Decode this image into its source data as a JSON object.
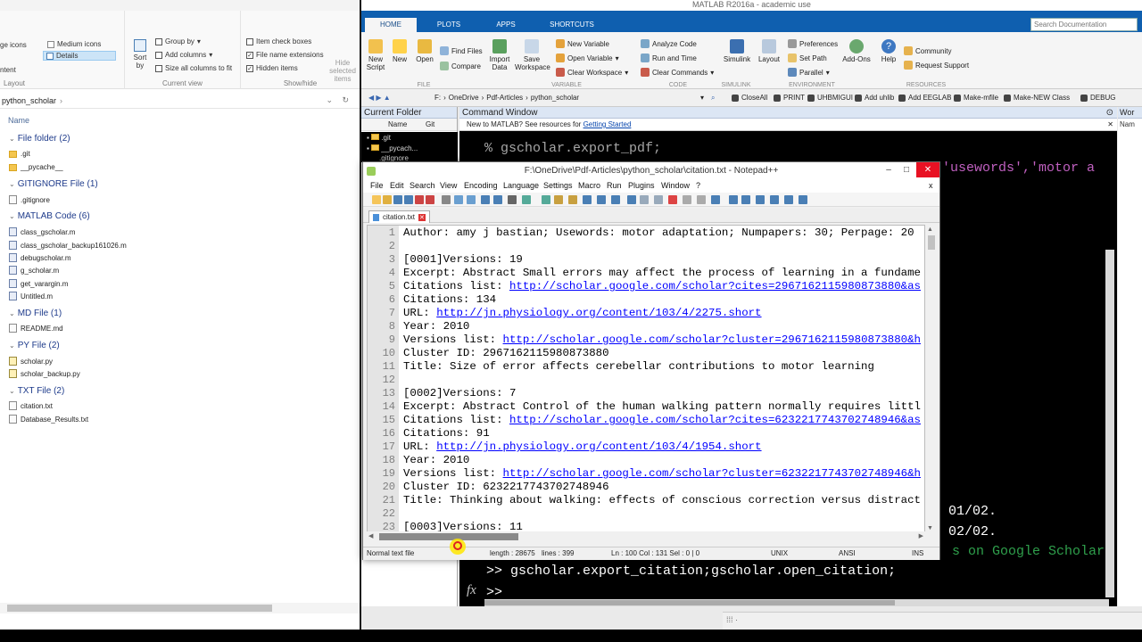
{
  "explorer": {
    "ribbon": {
      "large_icons": "ge icons",
      "medium_icons": "Medium icons",
      "content": "ntent",
      "details": "Details",
      "layout_label": "Layout",
      "sort_by": "Sort by",
      "group_by": "Group by",
      "add_columns": "Add columns",
      "size_columns": "Size all columns to fit",
      "current_view": "Current view",
      "item_checkboxes": "Item check boxes",
      "file_ext": "File name extensions",
      "hidden_items": "Hidden items",
      "hide_selected": "Hide selected items",
      "showhide": "Show/hide"
    },
    "path": "python_scholar",
    "column_name": "Name",
    "groups": [
      {
        "label": "File folder (2)",
        "items": [
          ".git",
          "__pycache__"
        ]
      },
      {
        "label": "GITIGNORE File (1)",
        "items": [
          ".gitignore"
        ]
      },
      {
        "label": "MATLAB Code (6)",
        "items": [
          "class_gscholar.m",
          "class_gscholar_backup161026.m",
          "debugscholar.m",
          "g_scholar.m",
          "get_varargin.m",
          "Untitled.m"
        ]
      },
      {
        "label": "MD File (1)",
        "items": [
          "README.md"
        ]
      },
      {
        "label": "PY File (2)",
        "items": [
          "scholar.py",
          "scholar_backup.py"
        ]
      },
      {
        "label": "TXT File (2)",
        "items": [
          "citation.txt",
          "Database_Results.txt"
        ]
      }
    ]
  },
  "matlab": {
    "title": "MATLAB R2016a - academic use",
    "tabs": [
      "HOME",
      "PLOTS",
      "APPS",
      "SHORTCUTS"
    ],
    "search_placeholder": "Search Documentation",
    "ribbon": {
      "new_script": "New Script",
      "new": "New",
      "open": "Open",
      "find_files": "Find Files",
      "compare": "Compare",
      "import_data": "Import Data",
      "save_workspace": "Save Workspace",
      "new_variable": "New Variable",
      "open_variable": "Open Variable",
      "clear_workspace": "Clear Workspace",
      "analyze_code": "Analyze Code",
      "run_and_time": "Run and Time",
      "clear_commands": "Clear Commands",
      "simulink": "Simulink",
      "layout": "Layout",
      "preferences": "Preferences",
      "set_path": "Set Path",
      "parallel": "Parallel",
      "addons": "Add-Ons",
      "help": "Help",
      "community": "Community",
      "request_support": "Request Support",
      "g_file": "FILE",
      "g_variable": "VARIABLE",
      "g_code": "CODE",
      "g_simulink": "SIMULINK",
      "g_environment": "ENVIRONMENT",
      "g_resources": "RESOURCES"
    },
    "address": [
      "F:",
      "OneDrive",
      "Pdf-Articles",
      "python_scholar"
    ],
    "shortcuts": [
      "CloseAll",
      "PRINT",
      "UHBMIGUI",
      "Add uhlib",
      "Add EEGLAB",
      "Make-mfile",
      "Make-NEW Class",
      "DEBUG"
    ],
    "current_folder_title": "Current Folder",
    "cf_cols": [
      "Name",
      "Git"
    ],
    "cf_items": [
      ".git",
      "__pycach...",
      ".gitignore"
    ],
    "command_window_title": "Command Window",
    "banner_prefix": "New to MATLAB? See resources for ",
    "banner_link": "Getting Started",
    "cmd_lines": {
      "comment": "% gscholar.export_pdf;",
      "partial_args": ",'usewords','motor a",
      "date1": "01/02.",
      "date2": "02/02.",
      "on_google": "s on Google Scholar",
      "prompt_cmd": ">> gscholar.export_citation;gscholar.open_citation;",
      "prompt": ">>"
    },
    "fx": "fx",
    "workspace_title": "Wor",
    "workspace_col": "Nam"
  },
  "notepad": {
    "title": "F:\\OneDrive\\Pdf-Articles\\python_scholar\\citation.txt - Notepad++",
    "menu": [
      "File",
      "Edit",
      "Search",
      "View",
      "Encoding",
      "Language",
      "Settings",
      "Macro",
      "Run",
      "Plugins",
      "Window",
      "?"
    ],
    "tab": "citation.txt",
    "lines": [
      {
        "n": "1",
        "t": " Author: amy j bastian; Usewords: motor adaptation; Numpapers: 30; Perpage: 20"
      },
      {
        "n": "2",
        "t": ""
      },
      {
        "n": "3",
        "t": "[0001]Versions: 19"
      },
      {
        "n": "4",
        "t": "Excerpt: Abstract Small errors may affect the process of learning in a fundame"
      },
      {
        "n": "5",
        "t": "Citations list: ",
        "u": "http://scholar.google.com/scholar?cites=2967162115980873880&as"
      },
      {
        "n": "6",
        "t": "Citations: 134"
      },
      {
        "n": "7",
        "t": "URL: ",
        "u": "http://jn.physiology.org/content/103/4/2275.short"
      },
      {
        "n": "8",
        "t": "Year: 2010"
      },
      {
        "n": "9",
        "t": "Versions list: ",
        "u": "http://scholar.google.com/scholar?cluster=2967162115980873880&h"
      },
      {
        "n": "10",
        "t": "Cluster ID: 2967162115980873880"
      },
      {
        "n": "11",
        "t": "Title: Size of error affects cerebellar contributions to motor learning"
      },
      {
        "n": "12",
        "t": ""
      },
      {
        "n": "13",
        "t": "[0002]Versions: 7"
      },
      {
        "n": "14",
        "t": "Excerpt: Abstract Control of the human walking pattern normally requires littl"
      },
      {
        "n": "15",
        "t": "Citations list: ",
        "u": "http://scholar.google.com/scholar?cites=6232217743702748946&as"
      },
      {
        "n": "16",
        "t": "Citations: 91"
      },
      {
        "n": "17",
        "t": "URL: ",
        "u": "http://jn.physiology.org/content/103/4/1954.short"
      },
      {
        "n": "18",
        "t": "Year: 2010"
      },
      {
        "n": "19",
        "t": "Versions list: ",
        "u": "http://scholar.google.com/scholar?cluster=6232217743702748946&h"
      },
      {
        "n": "20",
        "t": "Cluster ID: 6232217743702748946"
      },
      {
        "n": "21",
        "t": "Title: Thinking about walking: effects of conscious correction versus distract"
      },
      {
        "n": "22",
        "t": ""
      },
      {
        "n": "23",
        "t": "[0003]Versions: 11"
      }
    ],
    "status": {
      "type": "Normal text file",
      "length": "length : 28675",
      "lines": "lines : 399",
      "pos": "Ln : 100   Col : 131   Sel : 0 | 0",
      "eol": "UNIX",
      "enc": "ANSI",
      "mode": "INS"
    }
  }
}
